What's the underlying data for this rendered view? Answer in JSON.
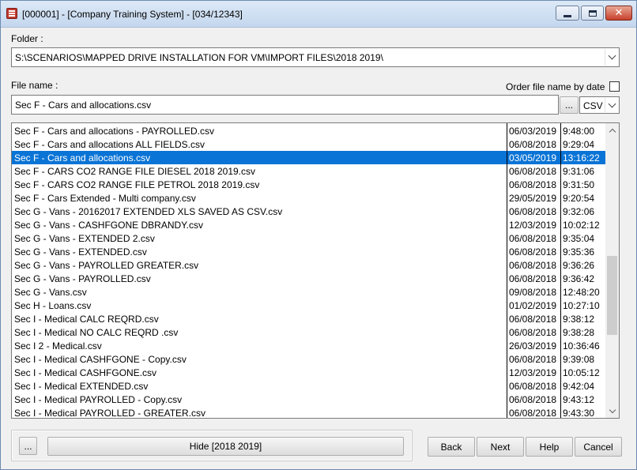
{
  "window": {
    "title": "[000001] - [Company Training System] - [034/12343]"
  },
  "folder": {
    "label": "Folder :",
    "value": "S:\\SCENARIOS\\MAPPED DRIVE INSTALLATION FOR VM\\IMPORT FILES\\2018 2019\\"
  },
  "file": {
    "label": "File name :",
    "value": "Sec F - Cars and allocations.csv",
    "browse_label": "...",
    "type_value": "CSV",
    "order_label": "Order file name by date",
    "order_checked": false
  },
  "files": [
    {
      "name": "Sec F - Cars and allocations - PAYROLLED.csv",
      "date": "06/03/2019",
      "time": "9:48:00"
    },
    {
      "name": "Sec F - Cars and allocations ALL FIELDS.csv",
      "date": "06/08/2018",
      "time": "9:29:04"
    },
    {
      "name": "Sec F - Cars and allocations.csv",
      "date": "03/05/2019",
      "time": "13:16:22",
      "selected": true
    },
    {
      "name": "Sec F - CARS CO2 RANGE FILE DIESEL 2018 2019.csv",
      "date": "06/08/2018",
      "time": "9:31:06"
    },
    {
      "name": "Sec F - CARS CO2 RANGE FILE PETROL 2018 2019.csv",
      "date": "06/08/2018",
      "time": "9:31:50"
    },
    {
      "name": "Sec F - Cars Extended - Multi company.csv",
      "date": "29/05/2019",
      "time": "9:20:54"
    },
    {
      "name": "Sec G - Vans - 20162017 EXTENDED XLS SAVED AS CSV.csv",
      "date": "06/08/2018",
      "time": "9:32:06"
    },
    {
      "name": "Sec G - Vans - CASHFGONE DBRANDY.csv",
      "date": "12/03/2019",
      "time": "10:02:12"
    },
    {
      "name": "Sec G - Vans - EXTENDED 2.csv",
      "date": "06/08/2018",
      "time": "9:35:04"
    },
    {
      "name": "Sec G - Vans - EXTENDED.csv",
      "date": "06/08/2018",
      "time": "9:35:36"
    },
    {
      "name": "Sec G - Vans - PAYROLLED GREATER.csv",
      "date": "06/08/2018",
      "time": "9:36:26"
    },
    {
      "name": "Sec G - Vans - PAYROLLED.csv",
      "date": "06/08/2018",
      "time": "9:36:42"
    },
    {
      "name": "Sec G - Vans.csv",
      "date": "09/08/2018",
      "time": "12:48:20"
    },
    {
      "name": "Sec H - Loans.csv",
      "date": "01/02/2019",
      "time": "10:27:10"
    },
    {
      "name": "Sec I  - Medical CALC REQRD.csv",
      "date": "06/08/2018",
      "time": "9:38:12"
    },
    {
      "name": "Sec I  - Medical NO CALC REQRD .csv",
      "date": "06/08/2018",
      "time": "9:38:28"
    },
    {
      "name": "Sec I  2 - Medical.csv",
      "date": "26/03/2019",
      "time": "10:36:46"
    },
    {
      "name": "Sec I - Medical CASHFGONE - Copy.csv",
      "date": "06/08/2018",
      "time": "9:39:08"
    },
    {
      "name": "Sec I - Medical CASHFGONE.csv",
      "date": "12/03/2019",
      "time": "10:05:12"
    },
    {
      "name": "Sec I - Medical EXTENDED.csv",
      "date": "06/08/2018",
      "time": "9:42:04"
    },
    {
      "name": "Sec I - Medical PAYROLLED - Copy.csv",
      "date": "06/08/2018",
      "time": "9:43:12"
    },
    {
      "name": "Sec I - Medical PAYROLLED - GREATER.csv",
      "date": "06/08/2018",
      "time": "9:43:30"
    }
  ],
  "footer": {
    "more_label": "...",
    "hide_label": "Hide [2018 2019]",
    "back_label": "Back",
    "next_label": "Next",
    "help_label": "Help",
    "cancel_label": "Cancel"
  },
  "icons": {
    "app": "app-icon",
    "minimize": "minimize-icon",
    "maximize": "maximize-icon",
    "close": "close-icon"
  },
  "colors": {
    "selection": "#0a74d6",
    "close_button": "#c7402b"
  }
}
